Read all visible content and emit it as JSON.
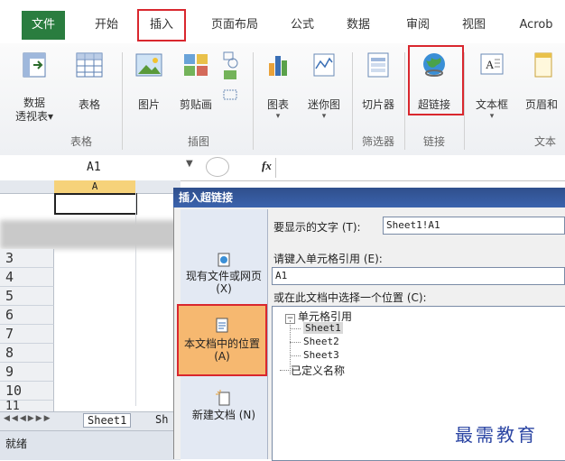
{
  "ribbon": {
    "tabs": [
      "文件",
      "开始",
      "插入",
      "页面布局",
      "公式",
      "数据",
      "审阅",
      "视图",
      "Acrob"
    ],
    "active_tab": "插入",
    "groups": [
      {
        "label": "表格",
        "buttons": [
          "数据\n透视表▾",
          "表格"
        ]
      },
      {
        "label": "插图",
        "buttons": [
          "图片",
          "剪贴画"
        ]
      },
      {
        "label": "",
        "buttons": [
          "图表",
          "迷你图"
        ]
      },
      {
        "label": "筛选器",
        "buttons": [
          "切片器"
        ]
      },
      {
        "label": "链接",
        "buttons": [
          "超链接"
        ]
      },
      {
        "label": "文本",
        "buttons": [
          "文本框",
          "页眉和"
        ]
      }
    ]
  },
  "formula_bar": {
    "name_box": "A1",
    "fx": "fx"
  },
  "grid": {
    "column_header": "A",
    "rows": [
      "3",
      "4",
      "5",
      "6",
      "7",
      "8",
      "9",
      "10",
      "11"
    ],
    "sheet_tab_partial": "Sheet1",
    "sheet_tab_partial2": "Sh",
    "status": "就绪"
  },
  "dialog": {
    "title": "插入超链接",
    "text_to_display_label": "要显示的文字 (T):",
    "text_to_display_value": "Sheet1!A1",
    "cell_ref_label": "请键入单元格引用 (E):",
    "cell_ref_value": "A1",
    "choose_place_label": "或在此文档中选择一个位置 (C):",
    "sidebar": [
      {
        "label": "现有文件或网页 (X)"
      },
      {
        "label": "本文档中的位置 (A)"
      },
      {
        "label": "新建文档 (N)"
      }
    ],
    "tree": {
      "root": "单元格引用",
      "sheets": [
        "Sheet1",
        "Sheet2",
        "Sheet3"
      ],
      "defined": "已定义名称"
    }
  },
  "watermark": "最需教育"
}
